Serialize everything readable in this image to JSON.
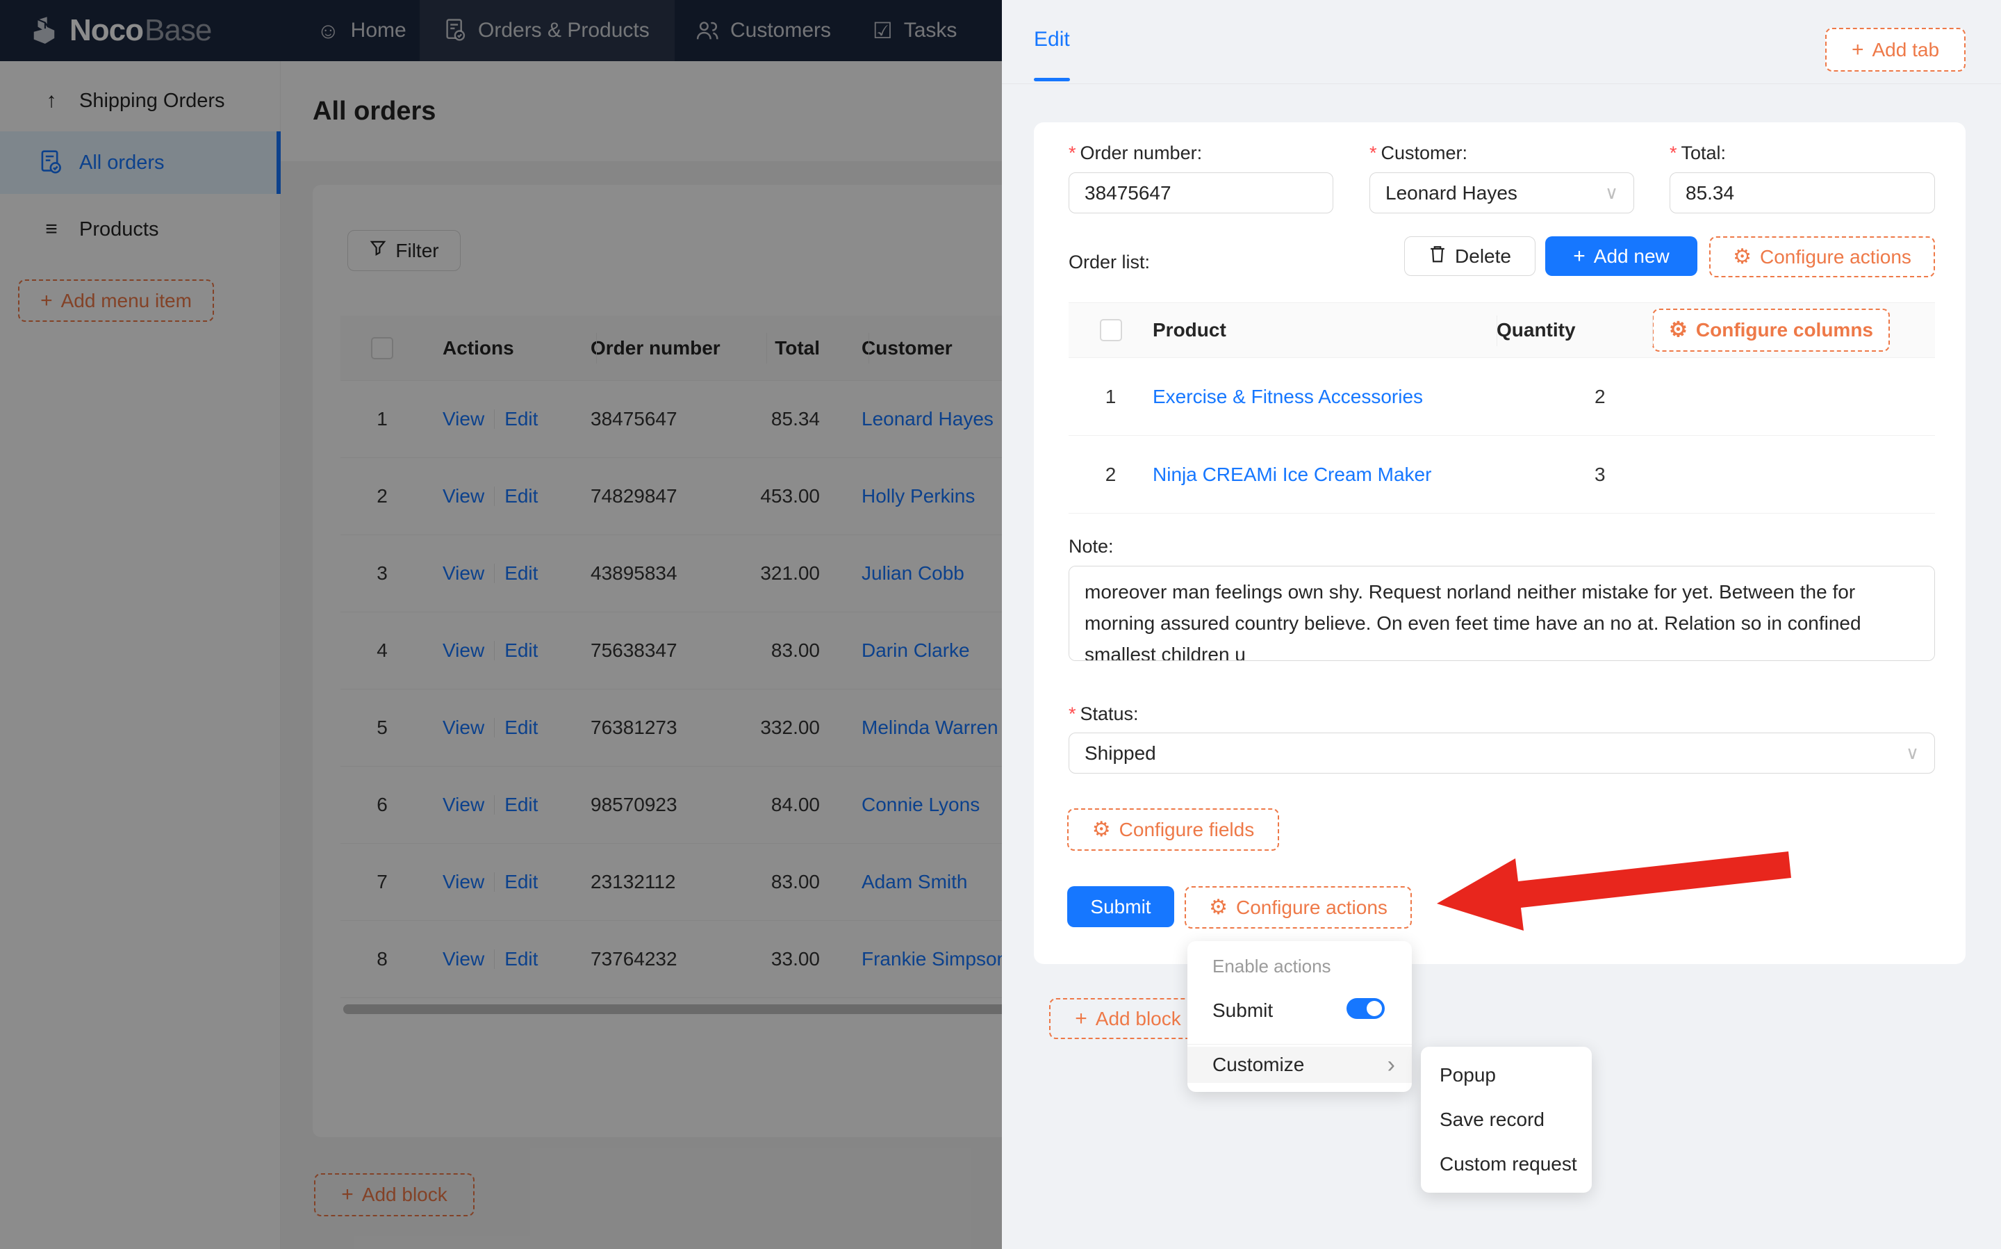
{
  "colors": {
    "accent_blue": "#1677ff",
    "designer_orange": "#ee7948",
    "arrow_red": "#e8261d",
    "required_red": "#ff4d4f",
    "navbar_bg": "#1d2841",
    "drawer_bg": "#f0f2f5",
    "selected_menu_bg": "#e6f4ff"
  },
  "icons": {
    "smiley": "☺",
    "tasks_check": "☑",
    "up_arrow": "↑",
    "menu_list": "≡",
    "gear": "⚙",
    "plus": "+",
    "chevron_down": "∨",
    "chevron_right": "›"
  },
  "navbar": {
    "logo_bold": "Noco",
    "logo_light": "Base",
    "items": [
      {
        "label": "Home"
      },
      {
        "label": "Orders & Products"
      },
      {
        "label": "Customers"
      },
      {
        "label": "Tasks"
      }
    ]
  },
  "sidebar": {
    "items": [
      {
        "label": "Shipping Orders"
      },
      {
        "label": "All orders"
      },
      {
        "label": "Products"
      }
    ],
    "add_menu_item": "Add menu item"
  },
  "main": {
    "title": "All orders",
    "filter": "Filter",
    "add_block": "Add block",
    "table": {
      "headers": {
        "actions": "Actions",
        "order_number": "Order number",
        "total": "Total",
        "customer": "Customer"
      },
      "view": "View",
      "edit": "Edit",
      "rows": [
        {
          "index": "1",
          "order_number": "38475647",
          "total": "85.34",
          "customer": "Leonard Hayes"
        },
        {
          "index": "2",
          "order_number": "74829847",
          "total": "453.00",
          "customer": "Holly Perkins"
        },
        {
          "index": "3",
          "order_number": "43895834",
          "total": "321.00",
          "customer": "Julian Cobb"
        },
        {
          "index": "4",
          "order_number": "75638347",
          "total": "83.00",
          "customer": "Darin Clarke"
        },
        {
          "index": "5",
          "order_number": "76381273",
          "total": "332.00",
          "customer": "Melinda Warren"
        },
        {
          "index": "6",
          "order_number": "98570923",
          "total": "84.00",
          "customer": "Connie Lyons"
        },
        {
          "index": "7",
          "order_number": "23132112",
          "total": "83.00",
          "customer": "Adam Smith"
        },
        {
          "index": "8",
          "order_number": "73764232",
          "total": "33.00",
          "customer": "Frankie Simpson"
        }
      ]
    }
  },
  "drawer": {
    "tab": "Edit",
    "add_tab": "Add tab",
    "add_block": "Add block",
    "form": {
      "order_number_label": "Order number:",
      "order_number_value": "38475647",
      "customer_label": "Customer:",
      "customer_value": "Leonard Hayes",
      "total_label": "Total:",
      "total_value": "85.34",
      "order_list_label": "Order list:",
      "delete": "Delete",
      "add_new": "Add new",
      "configure_actions": "Configure actions",
      "subtable": {
        "product_header": "Product",
        "quantity_header": "Quantity",
        "configure_columns": "Configure columns",
        "rows": [
          {
            "index": "1",
            "product": "Exercise & Fitness Accessories",
            "quantity": "2"
          },
          {
            "index": "2",
            "product": "Ninja CREAMi Ice Cream Maker",
            "quantity": "3"
          }
        ]
      },
      "note_label": "Note:",
      "note_value": "moreover man feelings own shy. Request norland neither mistake for yet. Between the for morning assured country believe. On even feet time have an no at. Relation so in confined smallest children u",
      "status_label": "Status:",
      "status_value": "Shipped",
      "configure_fields": "Configure fields",
      "submit": "Submit"
    },
    "menu": {
      "group": "Enable actions",
      "submit": "Submit",
      "customize": "Customize",
      "submenu": [
        {
          "label": "Popup"
        },
        {
          "label": "Save record"
        },
        {
          "label": "Custom request"
        }
      ]
    }
  }
}
